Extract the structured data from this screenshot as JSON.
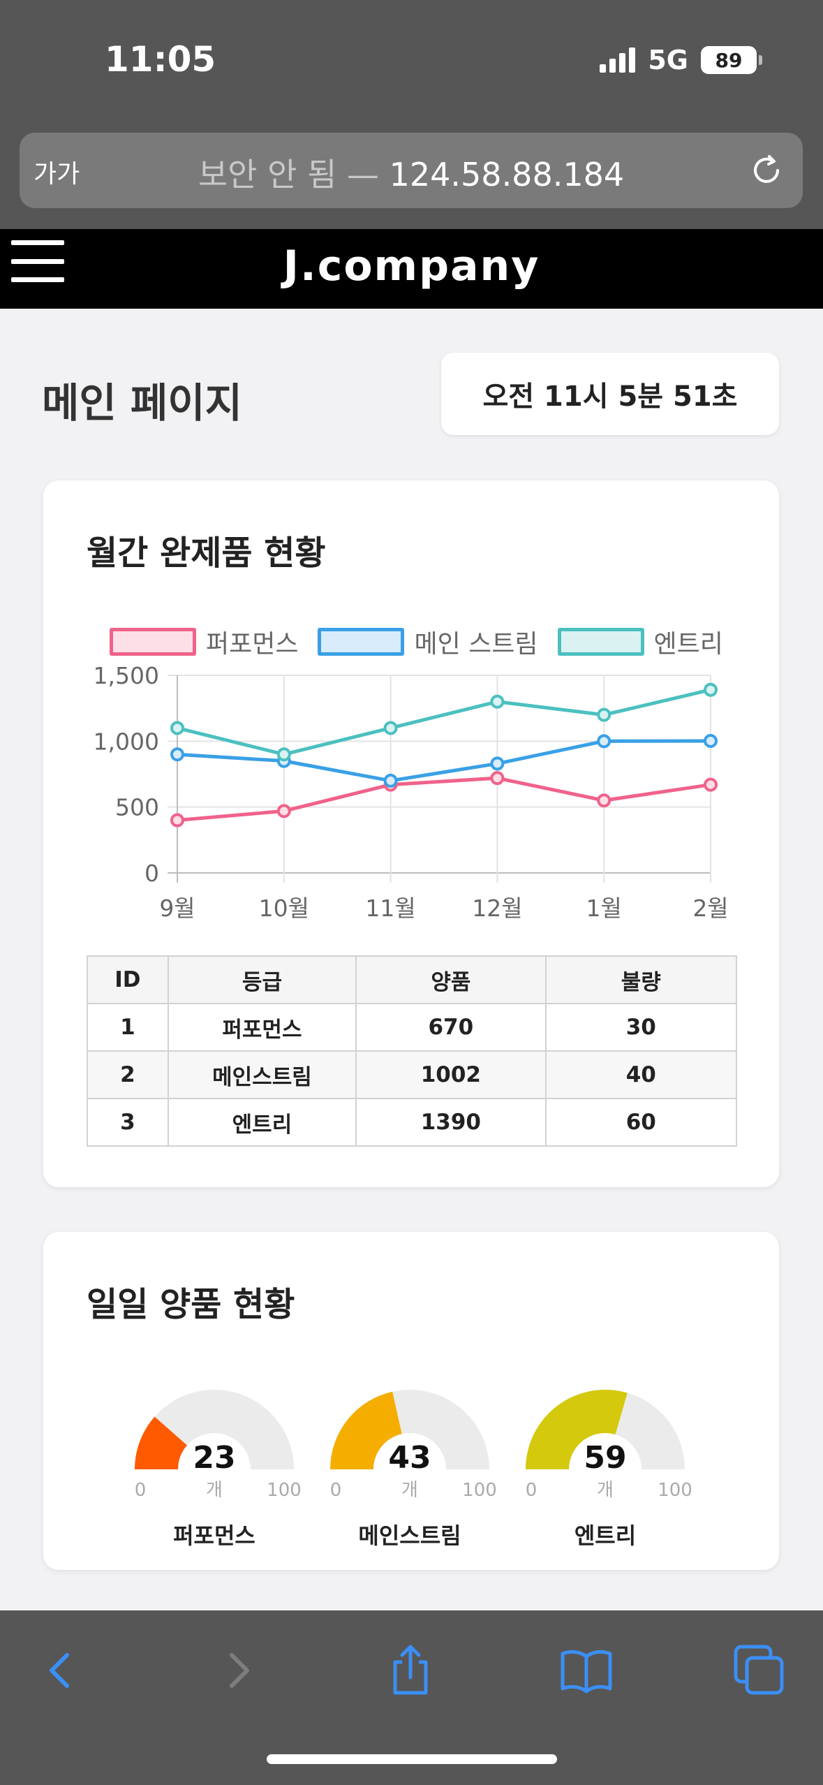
{
  "status_bar": {
    "time": "11:05",
    "network": "5G",
    "battery": "89"
  },
  "browser": {
    "text_size_label": "가가",
    "url_prefix": "보안 안 됨 —",
    "url": "124.58.88.184",
    "icons": [
      "reload-icon",
      "back-icon",
      "forward-icon",
      "share-icon",
      "bookmarks-icon",
      "tabs-icon"
    ]
  },
  "header": {
    "brand": "J.company",
    "icon": "menu-icon"
  },
  "page": {
    "title": "메인 페이지",
    "clock": "오전 11시 5분 51초"
  },
  "monthly": {
    "title": "월간 완제품 현황",
    "table": {
      "headers": [
        "ID",
        "등급",
        "양품",
        "불량"
      ],
      "rows": [
        [
          "1",
          "퍼포먼스",
          "670",
          "30"
        ],
        [
          "2",
          "메인스트림",
          "1002",
          "40"
        ],
        [
          "3",
          "엔트리",
          "1390",
          "60"
        ]
      ]
    }
  },
  "chart_data": {
    "type": "line",
    "x": [
      "9월",
      "10월",
      "11월",
      "12월",
      "1월",
      "2월"
    ],
    "ylim": [
      0,
      1500
    ],
    "yticks": [
      "0",
      "500",
      "1,000",
      "1,500"
    ],
    "grid": true,
    "legend_position": "top",
    "series": [
      {
        "name": "퍼포먼스",
        "values": [
          400,
          470,
          670,
          720,
          550,
          670
        ],
        "color": "#f0628a",
        "fill": "#fde0e7"
      },
      {
        "name": "메인 스트림",
        "values": [
          900,
          850,
          700,
          830,
          1000,
          1002
        ],
        "color": "#3aa0e6",
        "fill": "#d9ecfb"
      },
      {
        "name": "엔트리",
        "values": [
          1100,
          900,
          1100,
          1300,
          1200,
          1390
        ],
        "color": "#4cc0c0",
        "fill": "#dbf2f2"
      }
    ]
  },
  "daily": {
    "title": "일일 양품 현황",
    "unit": "개",
    "min_label": "0",
    "max_label": "100",
    "gauges": [
      {
        "name": "퍼포먼스",
        "value": 23,
        "value_label": "23",
        "max": 100,
        "color": "#ff5a00"
      },
      {
        "name": "메인스트림",
        "value": 43,
        "value_label": "43",
        "max": 100,
        "color": "#f5ae00"
      },
      {
        "name": "엔트리",
        "value": 59,
        "value_label": "59",
        "max": 100,
        "color": "#d4c90c"
      }
    ]
  }
}
